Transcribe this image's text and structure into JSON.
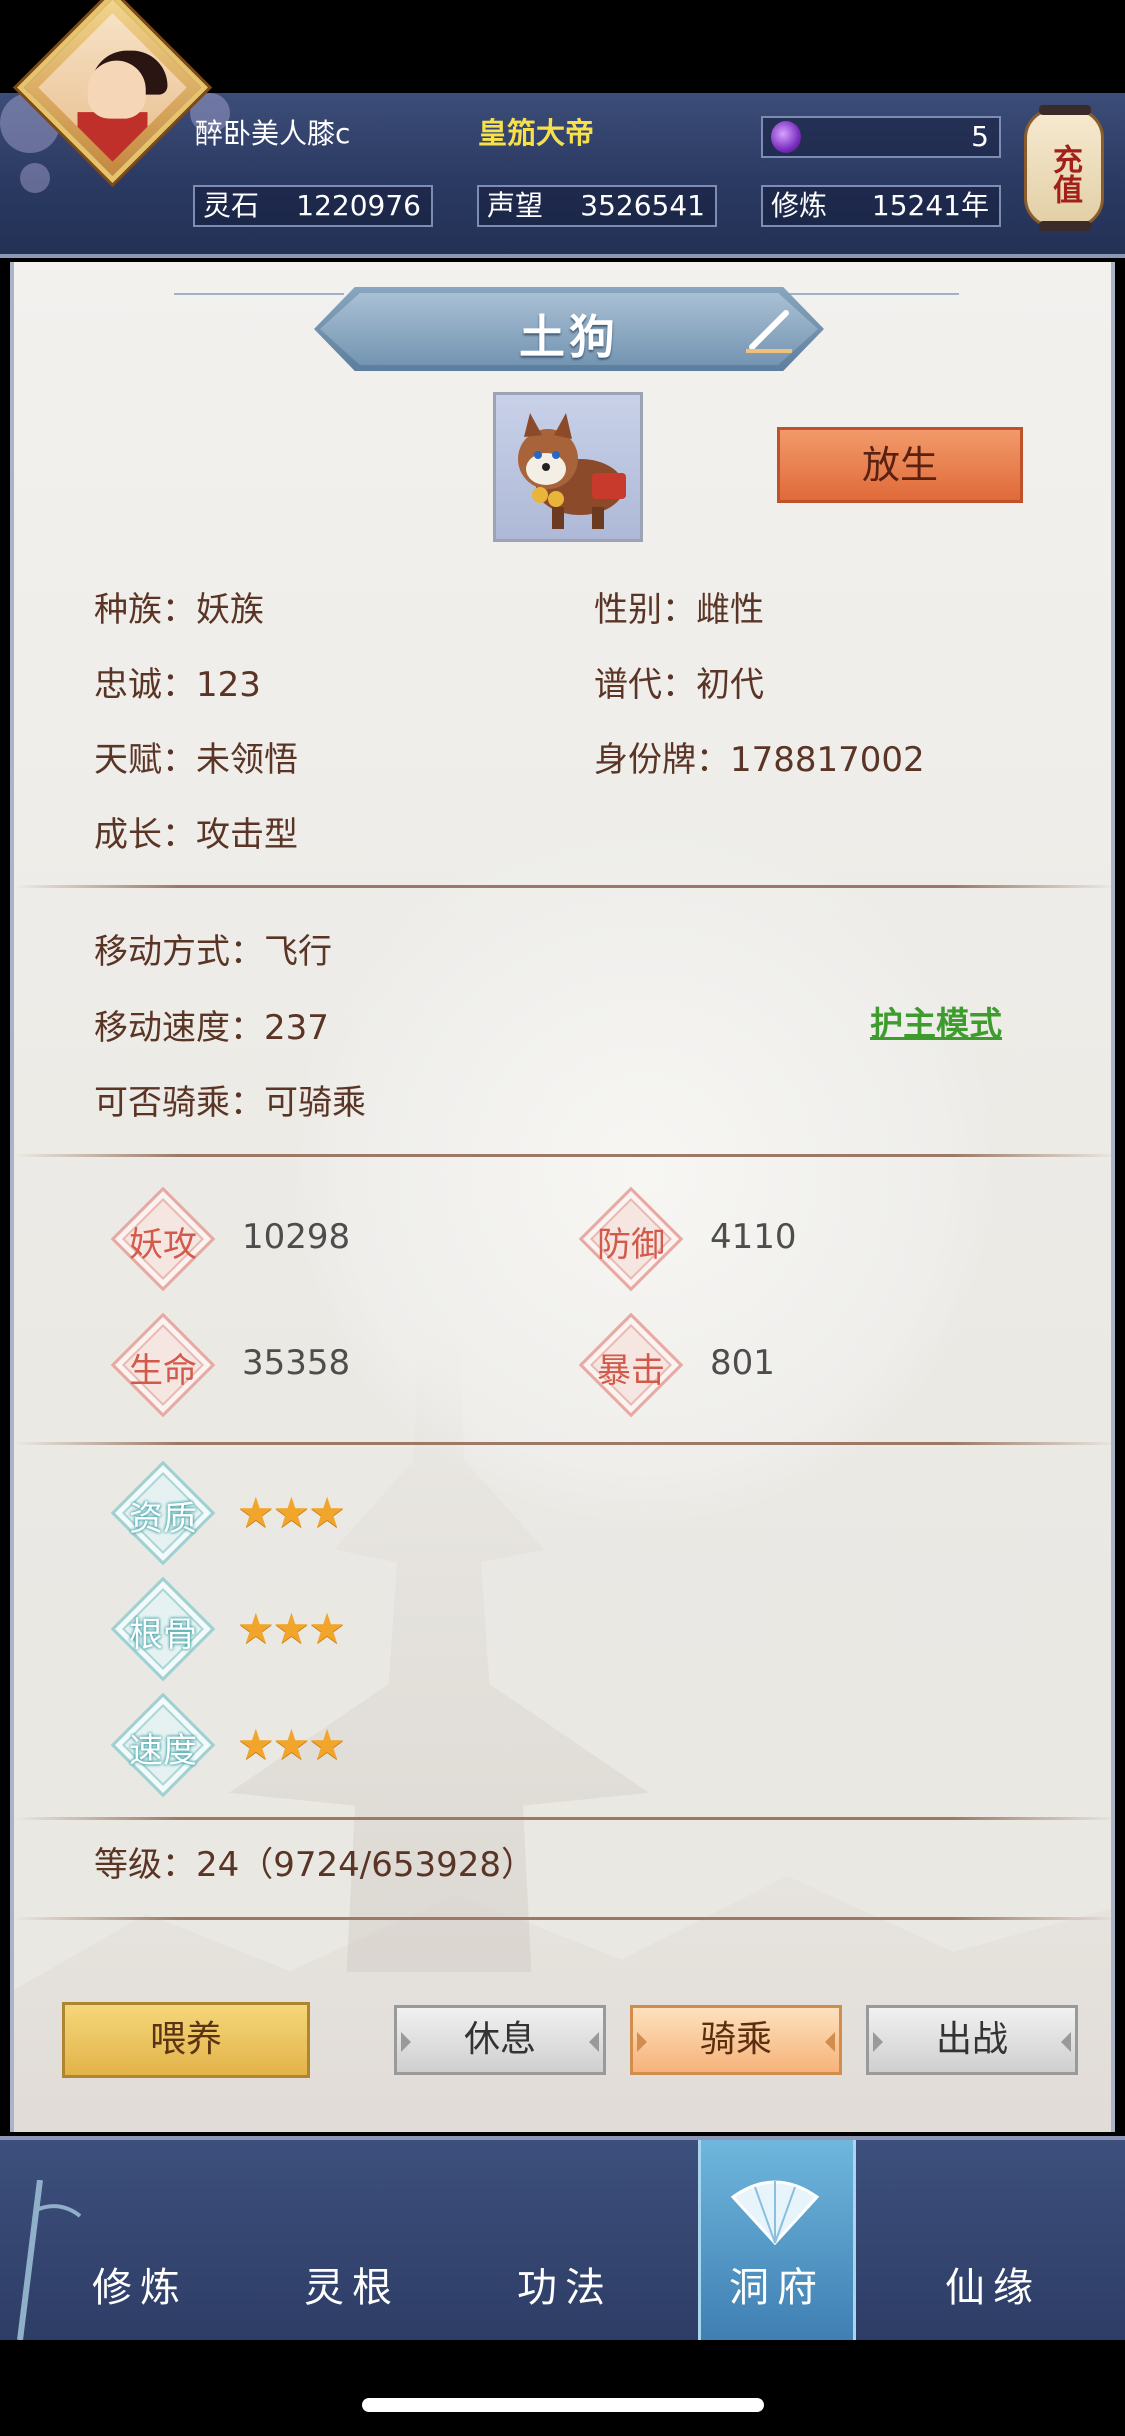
{
  "header": {
    "player_name": "醉卧美人膝c",
    "player_title": "皇笳大帝",
    "gems_value": "5",
    "stones_label": "灵石",
    "stones_value": "1220976",
    "fame_label": "声望",
    "fame_value": "3526541",
    "cultivation_label": "修炼",
    "cultivation_value": "15241年",
    "recharge_label": "充值",
    "gem_icon": "purple-gem-icon"
  },
  "pet": {
    "name": "土狗",
    "release_label": "放生",
    "race": "种族：妖族",
    "gender": "性别：雌性",
    "loyalty": "忠诚：123",
    "generation": "谱代：初代",
    "talent": "天赋：未领悟",
    "id_tag": "身份牌：178817002",
    "growth": "成长：攻击型",
    "move_mode": "移动方式：飞行",
    "move_speed": "移动速度：237",
    "rideable": "可否骑乘：可骑乘",
    "guard_mode_link": "护主模式",
    "level": "等级：24（9724/653928）"
  },
  "combat": {
    "attack_label": "妖攻",
    "attack_value": "10298",
    "defense_label": "防御",
    "defense_value": "4110",
    "hp_label": "生命",
    "hp_value": "35358",
    "crit_label": "暴击",
    "crit_value": "801"
  },
  "aptitude": {
    "quality_label": "资质",
    "quality_stars": 3,
    "bone_label": "根骨",
    "bone_stars": 3,
    "speed_label": "速度",
    "speed_stars": 3,
    "star_glyphs": "★★★"
  },
  "actions": {
    "feed": "喂养",
    "rest": "休息",
    "ride": "骑乘",
    "battle": "出战"
  },
  "nav": {
    "items": [
      {
        "label": "修炼"
      },
      {
        "label": "灵根"
      },
      {
        "label": "功法"
      },
      {
        "label": "洞府"
      },
      {
        "label": "仙缘"
      }
    ],
    "active_index": 3
  },
  "colors": {
    "accent_orange": "#e06a3a",
    "link_green": "#3e9b2e",
    "title_yellow": "#f7e14a",
    "text_brown": "#5a3425"
  }
}
